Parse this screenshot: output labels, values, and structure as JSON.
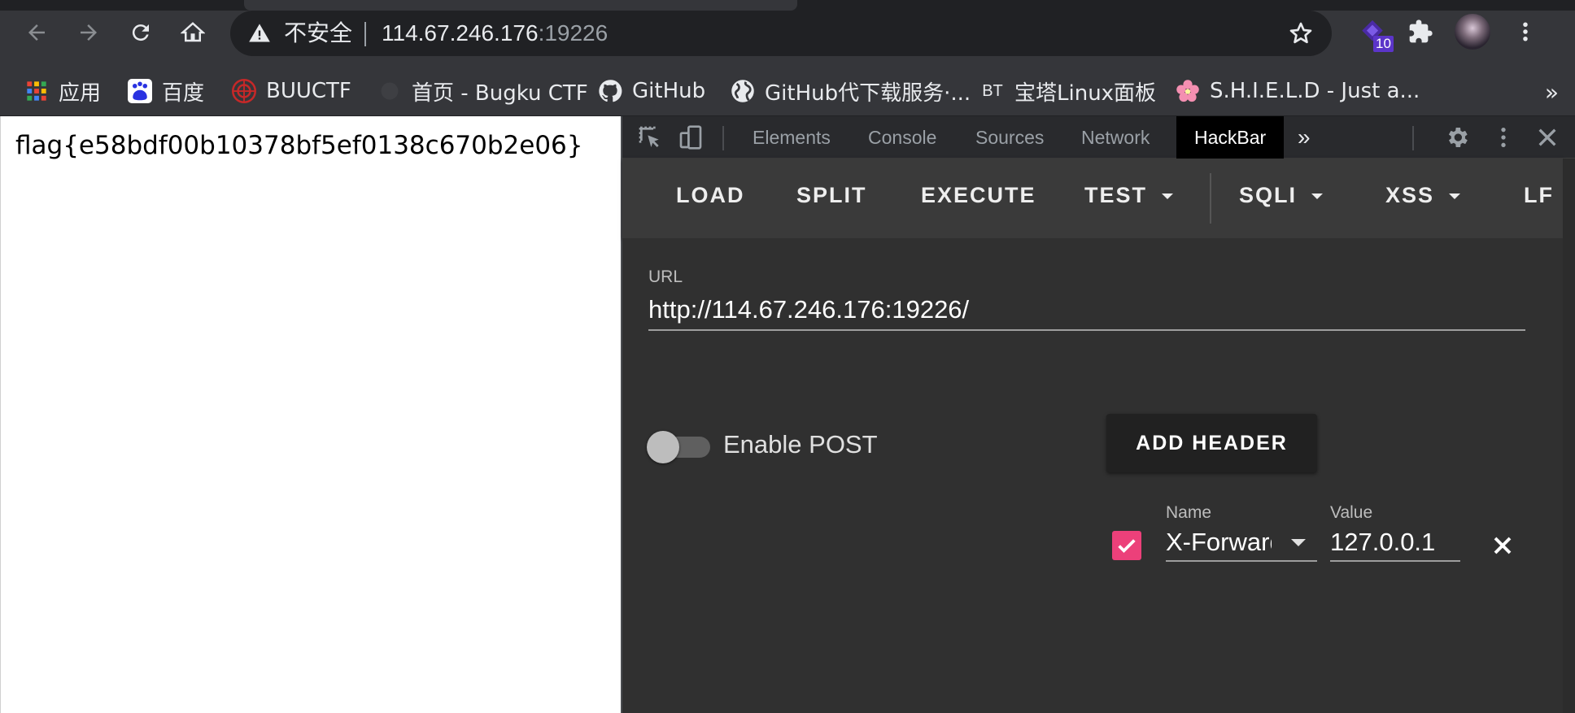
{
  "browser": {
    "address": {
      "security_label": "不安全",
      "host": "114.67.246.176",
      "port": ":19226"
    },
    "extension_badge": "10"
  },
  "bookmarks": {
    "items": [
      {
        "label": "应用",
        "icon": "apps-grid-icon"
      },
      {
        "label": "百度",
        "icon": "baidu-icon"
      },
      {
        "label": "BUUCTF",
        "icon": "buuctf-icon"
      },
      {
        "label": "首页 - Bugku CTF",
        "icon": "bugku-icon"
      },
      {
        "label": "GitHub",
        "icon": "github-icon"
      },
      {
        "label": "GitHub代下载服务·...",
        "icon": "globe-icon"
      },
      {
        "label": "宝塔Linux面板",
        "icon": "bt-icon",
        "icon_text": "BT"
      },
      {
        "label": "S.H.I.E.L.D - Just a...",
        "icon": "flower-icon"
      }
    ],
    "more": "»"
  },
  "page": {
    "flag_text": "flag{e58bdf00b10378bf5ef0138c670b2e06}"
  },
  "devtools": {
    "tabs": [
      "Elements",
      "Console",
      "Sources",
      "Network",
      "HackBar"
    ],
    "active_tab": "HackBar",
    "more_tabs": "»"
  },
  "hackbar": {
    "toolbar": {
      "load": "LOAD",
      "split": "SPLIT",
      "execute": "EXECUTE",
      "test": "TEST",
      "sqli": "SQLI",
      "xss": "XSS",
      "lfi": "LF"
    },
    "url_label": "URL",
    "url_value": "http://114.67.246.176:19226/",
    "enable_post_label": "Enable POST",
    "enable_post": false,
    "add_header_label": "ADD HEADER",
    "headers": [
      {
        "enabled": true,
        "name_label": "Name",
        "name": "X-Forwarded-For",
        "value_label": "Value",
        "value": "127.0.0.1"
      }
    ]
  },
  "colors": {
    "accent_pink": "#ec407a",
    "badge_purple": "#5b35c9",
    "devtools_bg": "#303030"
  }
}
